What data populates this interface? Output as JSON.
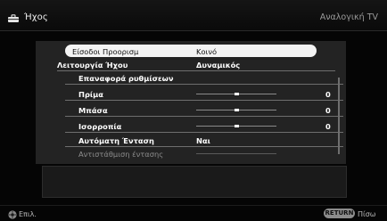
{
  "header": {
    "title": "Ήχος",
    "source": "Αναλογική TV",
    "icon": "toolbox-icon"
  },
  "menu": {
    "items": [
      {
        "label": "Είσοδοι Προορισμ",
        "value": "Κοινό",
        "selected": true
      },
      {
        "label": "Λειτουργία Ήχου",
        "value": "Δυναμικός"
      },
      {
        "label": "Επαναφορά ρυθμίσεων"
      },
      {
        "label": "Πρίμα",
        "value": "0",
        "slider_level": 0.5
      },
      {
        "label": "Μπάσα",
        "value": "0",
        "slider_level": 0.5
      },
      {
        "label": "Ισορροπία",
        "value": "0",
        "slider_level": 0.5
      },
      {
        "label": "Αυτόματη Ένταση",
        "value": "Ναι"
      },
      {
        "label": "Αντιστάθμιση έντασης",
        "disabled": true,
        "slider_level": 0.5
      }
    ]
  },
  "footer": {
    "enter_label": "Επιλ.",
    "return_key": "RETURN",
    "back_label": "Πίσω"
  },
  "colors": {
    "panel": "#232323",
    "highlight": "#f4f4f4",
    "background": "#050505"
  }
}
